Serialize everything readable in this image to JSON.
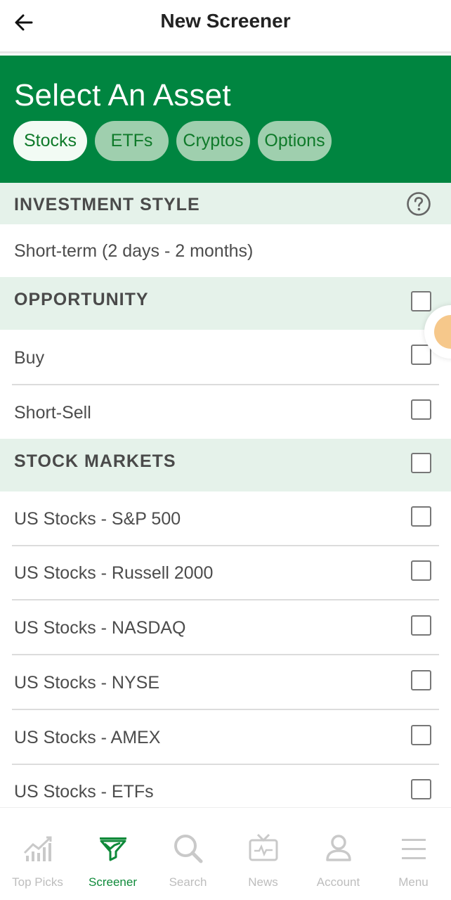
{
  "header": {
    "title": "New Screener",
    "back_icon": "arrow-left-icon"
  },
  "hero": {
    "title": "Select An Asset",
    "tabs": [
      {
        "label": "Stocks",
        "active": true
      },
      {
        "label": "ETFs",
        "active": false
      },
      {
        "label": "Cryptos",
        "active": false
      },
      {
        "label": "Options",
        "active": false
      }
    ],
    "bg_color": "#008540"
  },
  "investment_style": {
    "title": "INVESTMENT STYLE",
    "help_icon": "question-circle-icon",
    "value": "Short-term (2 days - 2 months)"
  },
  "opportunity": {
    "title": "OPPORTUNITY",
    "items": [
      {
        "label": "Buy",
        "checked": false
      },
      {
        "label": "Short-Sell",
        "checked": false
      }
    ]
  },
  "stock_markets": {
    "title": "STOCK MARKETS",
    "items": [
      {
        "label": "US Stocks - S&P 500",
        "checked": false
      },
      {
        "label": "US Stocks - Russell 2000",
        "checked": false
      },
      {
        "label": "US Stocks - NASDAQ",
        "checked": false
      },
      {
        "label": "US Stocks - NYSE",
        "checked": false
      },
      {
        "label": "US Stocks - AMEX",
        "checked": false
      },
      {
        "label": "US Stocks - ETFs",
        "checked": false
      }
    ]
  },
  "bottom_nav": {
    "items": [
      {
        "label": "Top Picks",
        "icon": "bar-chart-icon",
        "active": false
      },
      {
        "label": "Screener",
        "icon": "screener-funnel-icon",
        "active": true
      },
      {
        "label": "Search",
        "icon": "search-icon",
        "active": false
      },
      {
        "label": "News",
        "icon": "tv-news-icon",
        "active": false
      },
      {
        "label": "Account",
        "icon": "user-icon",
        "active": false
      },
      {
        "label": "Menu",
        "icon": "hamburger-menu-icon",
        "active": false
      }
    ],
    "active_color": "#0f8a3a",
    "inactive_color": "#bdbdbd"
  }
}
